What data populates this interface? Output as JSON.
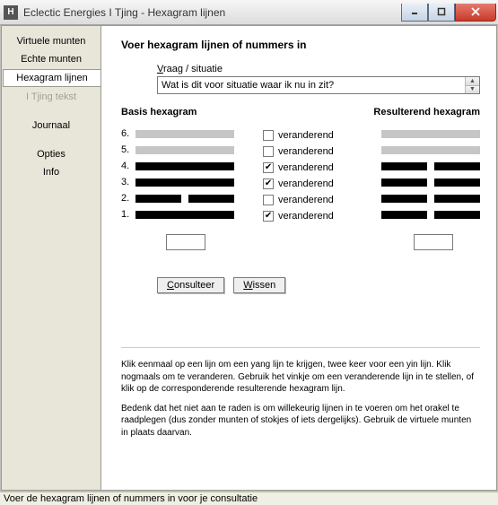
{
  "window": {
    "title": "Eclectic Energies I Tjing - Hexagram lijnen",
    "icon_letter": "H"
  },
  "sidebar": {
    "items": [
      {
        "label": "Virtuele munten",
        "state": "normal"
      },
      {
        "label": "Echte munten",
        "state": "normal"
      },
      {
        "label": "Hexagram lijnen",
        "state": "selected"
      },
      {
        "label": "I Tjing tekst",
        "state": "disabled"
      }
    ],
    "items2": [
      {
        "label": "Journaal",
        "state": "normal"
      }
    ],
    "items3": [
      {
        "label": "Opties",
        "state": "normal"
      },
      {
        "label": "Info",
        "state": "normal"
      }
    ]
  },
  "main": {
    "heading": "Voer hexagram lijnen of nummers in",
    "question_label": "Vraag / situatie",
    "question_value": "Wat is dit voor situatie waar ik nu in zit?",
    "basis_heading": "Basis hexagram",
    "result_heading": "Resulterend hexagram",
    "lines": [
      {
        "n": "6.",
        "basis": "none",
        "changing": false,
        "result": "none"
      },
      {
        "n": "5.",
        "basis": "none",
        "changing": false,
        "result": "none"
      },
      {
        "n": "4.",
        "basis": "yang",
        "changing": true,
        "result": "yin"
      },
      {
        "n": "3.",
        "basis": "yang",
        "changing": true,
        "result": "yin"
      },
      {
        "n": "2.",
        "basis": "yin",
        "changing": false,
        "result": "yin"
      },
      {
        "n": "1.",
        "basis": "yang",
        "changing": true,
        "result": "yin"
      }
    ],
    "changing_label": "veranderend",
    "basis_number": "",
    "result_number": "",
    "consult_btn": "Consulteer",
    "clear_btn": "Wissen",
    "help1": "Klik eenmaal op een lijn om een yang lijn te krijgen, twee keer voor een yin lijn. Klik nogmaals om te veranderen. Gebruik het vinkje om een veranderende lijn in te stellen, of klik op de corresponderende resulterende hexagram lijn.",
    "help2": "Bedenk dat het niet aan te raden is om willekeurig lijnen in te voeren om het orakel te raadplegen (dus zonder munten of stokjes of iets dergelijks). Gebruik de virtuele munten in plaats daarvan."
  },
  "statusbar": "Voer de hexagram lijnen of nummers in voor je consultatie"
}
